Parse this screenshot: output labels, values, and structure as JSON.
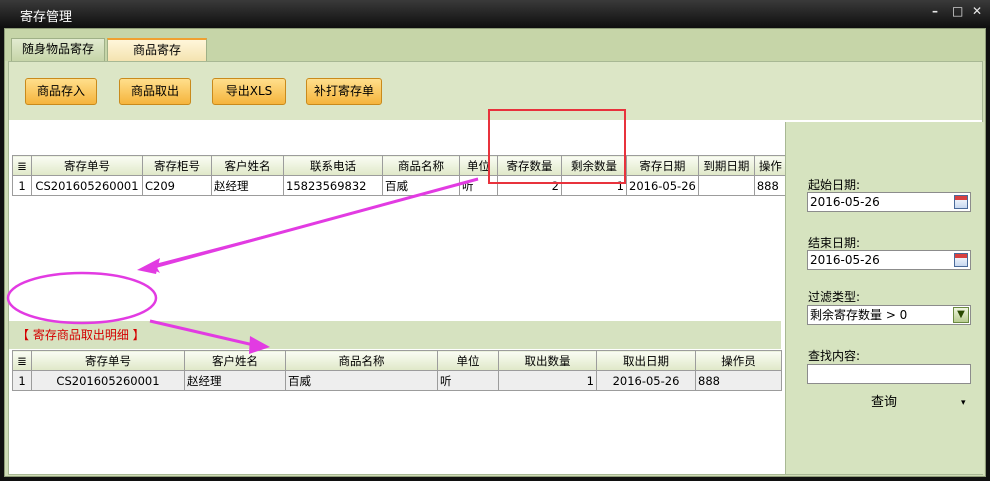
{
  "window": {
    "title": "寄存管理",
    "minimize": "–",
    "restore": "□",
    "close": "✕"
  },
  "tabs": [
    {
      "label": "随身物品寄存"
    },
    {
      "label": "商品寄存"
    }
  ],
  "toolbar": {
    "store_label": "商品存入",
    "takeout_label": "商品取出",
    "export_label": "导出XLS",
    "reprint_label": "补打寄存单"
  },
  "grid_main": {
    "corner": "≣",
    "columns": [
      "寄存单号",
      "寄存柜号",
      "客户姓名",
      "联系电话",
      "商品名称",
      "单位",
      "寄存数量",
      "剩余数量",
      "寄存日期",
      "到期日期",
      "操作"
    ],
    "rows": [
      {
        "idx": "1",
        "cells": [
          "CS201605260001",
          "C209",
          "赵经理",
          "15823569832",
          "百威",
          "听",
          "2",
          "1",
          "2016-05-26",
          "",
          "888"
        ]
      }
    ]
  },
  "section": {
    "title": "【 寄存商品取出明细 】"
  },
  "grid_detail": {
    "corner": "≣",
    "columns": [
      "寄存单号",
      "客户姓名",
      "商品名称",
      "单位",
      "取出数量",
      "取出日期",
      "操作员"
    ],
    "rows": [
      {
        "idx": "1",
        "cells": [
          "CS201605260001",
          "赵经理",
          "百威",
          "听",
          "1",
          "2016-05-26",
          "888"
        ]
      }
    ]
  },
  "filter": {
    "start_label": "起始日期:",
    "start_value": "2016-05-26",
    "end_label": "结束日期:",
    "end_value": "2016-05-26",
    "type_label": "过滤类型:",
    "type_value": "剩余寄存数量 > 0",
    "search_label": "查找内容:",
    "search_value": "",
    "query_label": "查询",
    "query_arrow": "▾"
  },
  "colors": {
    "annotation_red": "#e8323c",
    "annotation_magenta": "#e23be2",
    "accent": "#f5b43c"
  }
}
